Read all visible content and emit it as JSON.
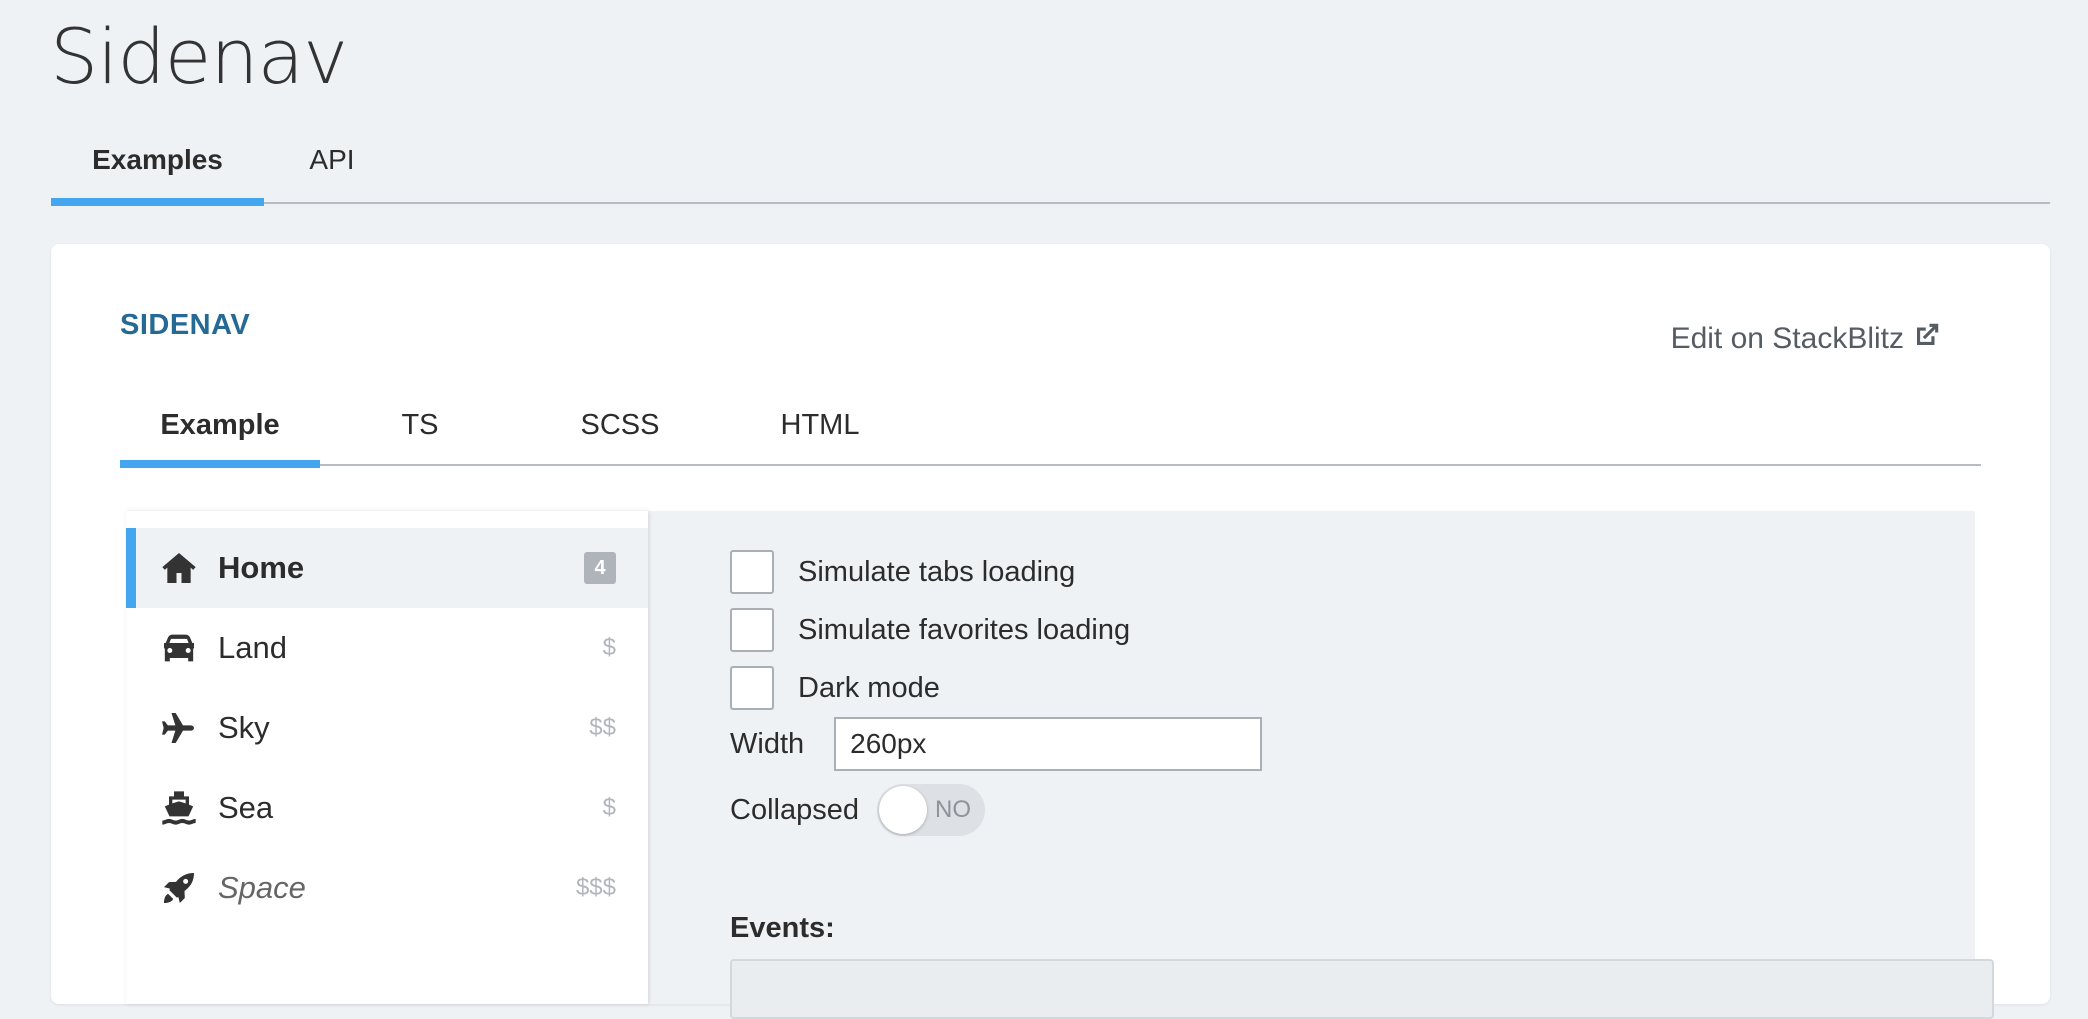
{
  "page": {
    "title": "Sidenav",
    "tabs": [
      {
        "label": "Examples",
        "active": true
      },
      {
        "label": "API",
        "active": false
      }
    ]
  },
  "card": {
    "section_title": "SIDENAV",
    "edit_link": "Edit on StackBlitz",
    "code_tabs": [
      {
        "label": "Example",
        "active": true
      },
      {
        "label": "TS",
        "active": false
      },
      {
        "label": "SCSS",
        "active": false
      },
      {
        "label": "HTML",
        "active": false
      }
    ]
  },
  "sidenav": {
    "items": [
      {
        "label": "Home",
        "icon": "home-icon",
        "meta": "4",
        "meta_type": "badge",
        "active": true
      },
      {
        "label": "Land",
        "icon": "car-icon",
        "meta": "$",
        "meta_type": "text"
      },
      {
        "label": "Sky",
        "icon": "plane-icon",
        "meta": "$$",
        "meta_type": "text"
      },
      {
        "label": "Sea",
        "icon": "ship-icon",
        "meta": "$",
        "meta_type": "text"
      },
      {
        "label": "Space",
        "icon": "rocket-icon",
        "meta": "$$$",
        "meta_type": "text",
        "disabled": true
      }
    ]
  },
  "controls": {
    "simulate_tabs_loading": {
      "label": "Simulate tabs loading",
      "checked": false
    },
    "simulate_favorites_loading": {
      "label": "Simulate favorites loading",
      "checked": false
    },
    "dark_mode": {
      "label": "Dark mode",
      "checked": false
    },
    "width": {
      "label": "Width",
      "value": "260px"
    },
    "collapsed": {
      "label": "Collapsed",
      "state_text": "NO",
      "on": false
    },
    "events_label": "Events:"
  },
  "colors": {
    "accent": "#44a6ee",
    "section_title": "#256a94",
    "background": "#eff2f5"
  }
}
